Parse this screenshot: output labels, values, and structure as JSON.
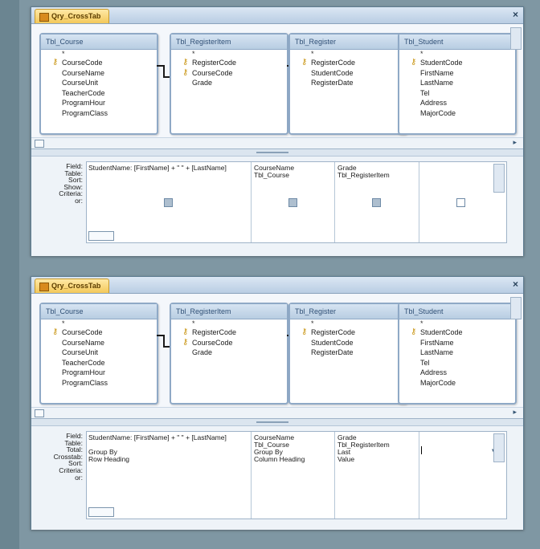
{
  "panels": [
    {
      "tab_title": "Qry_CrossTab",
      "tables": [
        {
          "name": "Tbl_Course",
          "fields": [
            {
              "name": "CourseCode",
              "key": true
            },
            {
              "name": "CourseName"
            },
            {
              "name": "CourseUnit"
            },
            {
              "name": "TeacherCode"
            },
            {
              "name": "ProgramHour"
            },
            {
              "name": "ProgramClass"
            }
          ]
        },
        {
          "name": "Tbl_RegisterItem",
          "fields": [
            {
              "name": "RegisterCode",
              "key": true
            },
            {
              "name": "CourseCode",
              "key": true
            },
            {
              "name": "Grade"
            }
          ]
        },
        {
          "name": "Tbl_Register",
          "fields": [
            {
              "name": "RegisterCode",
              "key": true
            },
            {
              "name": "StudentCode"
            },
            {
              "name": "RegisterDate"
            }
          ]
        },
        {
          "name": "Tbl_Student",
          "fields": [
            {
              "name": "StudentCode",
              "key": true
            },
            {
              "name": "FirstName"
            },
            {
              "name": "LastName"
            },
            {
              "name": "Tel"
            },
            {
              "name": "Address"
            },
            {
              "name": "MajorCode"
            }
          ]
        }
      ],
      "grid_labels": [
        "Field:",
        "Table:",
        "Sort:",
        "Show:",
        "Criteria:",
        "or:"
      ],
      "columns": [
        {
          "field": "StudentName: [FirstName] + \" \" + [LastName]",
          "table": "",
          "show": true
        },
        {
          "field": "CourseName",
          "table": "Tbl_Course",
          "show": true
        },
        {
          "field": "Grade",
          "table": "Tbl_RegisterItem",
          "show": true
        },
        {
          "field": "",
          "table": "",
          "show": false
        }
      ]
    },
    {
      "tab_title": "Qry_CrossTab",
      "tables": [
        {
          "name": "Tbl_Course",
          "fields": [
            {
              "name": "CourseCode",
              "key": true
            },
            {
              "name": "CourseName"
            },
            {
              "name": "CourseUnit"
            },
            {
              "name": "TeacherCode"
            },
            {
              "name": "ProgramHour"
            },
            {
              "name": "ProgramClass"
            }
          ]
        },
        {
          "name": "Tbl_RegisterItem",
          "fields": [
            {
              "name": "RegisterCode",
              "key": true
            },
            {
              "name": "CourseCode",
              "key": true
            },
            {
              "name": "Grade"
            }
          ]
        },
        {
          "name": "Tbl_Register",
          "fields": [
            {
              "name": "RegisterCode",
              "key": true
            },
            {
              "name": "StudentCode"
            },
            {
              "name": "RegisterDate"
            }
          ]
        },
        {
          "name": "Tbl_Student",
          "fields": [
            {
              "name": "StudentCode",
              "key": true
            },
            {
              "name": "FirstName"
            },
            {
              "name": "LastName"
            },
            {
              "name": "Tel"
            },
            {
              "name": "Address"
            },
            {
              "name": "MajorCode"
            }
          ]
        }
      ],
      "grid_labels": [
        "Field:",
        "Table:",
        "Total:",
        "Crosstab:",
        "Sort:",
        "Criteria:",
        "or:"
      ],
      "columns": [
        {
          "field": "StudentName: [FirstName] + \" \" + [LastName]",
          "table": "",
          "total": "Group By",
          "crosstab": "Row Heading"
        },
        {
          "field": "CourseName",
          "table": "Tbl_Course",
          "total": "Group By",
          "crosstab": "Column Heading"
        },
        {
          "field": "Grade",
          "table": "Tbl_RegisterItem",
          "total": "Last",
          "crosstab": "Value"
        },
        {
          "field": "",
          "table": "",
          "total": "",
          "crosstab": ""
        }
      ]
    }
  ]
}
